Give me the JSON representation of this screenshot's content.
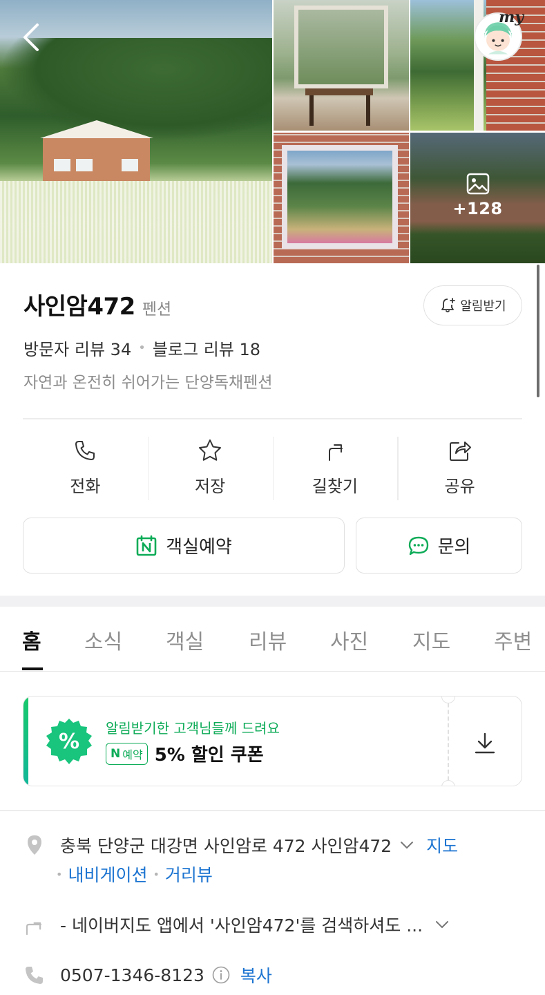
{
  "gallery": {
    "more_count": "+128",
    "my_badge": "my"
  },
  "place": {
    "name": "사인암472",
    "category": "펜션",
    "alarm_label": "알림받기",
    "visitor_reviews_label": "방문자 리뷰",
    "visitor_reviews_count": "34",
    "blog_reviews_label": "블로그 리뷰",
    "blog_reviews_count": "18",
    "description": "자연과 온전히 쉬어가는 단양독채펜션"
  },
  "actions": [
    {
      "label": "전화",
      "icon": "phone-icon"
    },
    {
      "label": "저장",
      "icon": "star-icon"
    },
    {
      "label": "길찾기",
      "icon": "directions-icon"
    },
    {
      "label": "공유",
      "icon": "share-icon"
    }
  ],
  "buttons": {
    "book_label": "객실예약",
    "inquiry_label": "문의"
  },
  "tabs": [
    "홈",
    "소식",
    "객실",
    "리뷰",
    "사진",
    "지도",
    "주변"
  ],
  "active_tab": "홈",
  "coupon": {
    "subtitle": "알림받기한 고객님들께 드려요",
    "badge_n": "N",
    "badge_label": "예약",
    "title": "5% 할인 쿠폰",
    "badge_symbol": "%"
  },
  "details": {
    "address": "충북 단양군 대강면 사인암로 472 사인암472",
    "map_link": "지도",
    "navigation_link": "내비게이션",
    "street_view_link": "거리뷰",
    "directions_text": "- 네이버지도 앱에서 '사인암472'를 검색하셔도 ...",
    "phone": "0507-1346-8123",
    "copy_label": "복사"
  },
  "colors": {
    "accent_green": "#0cab57",
    "link_blue": "#1c74d1"
  }
}
